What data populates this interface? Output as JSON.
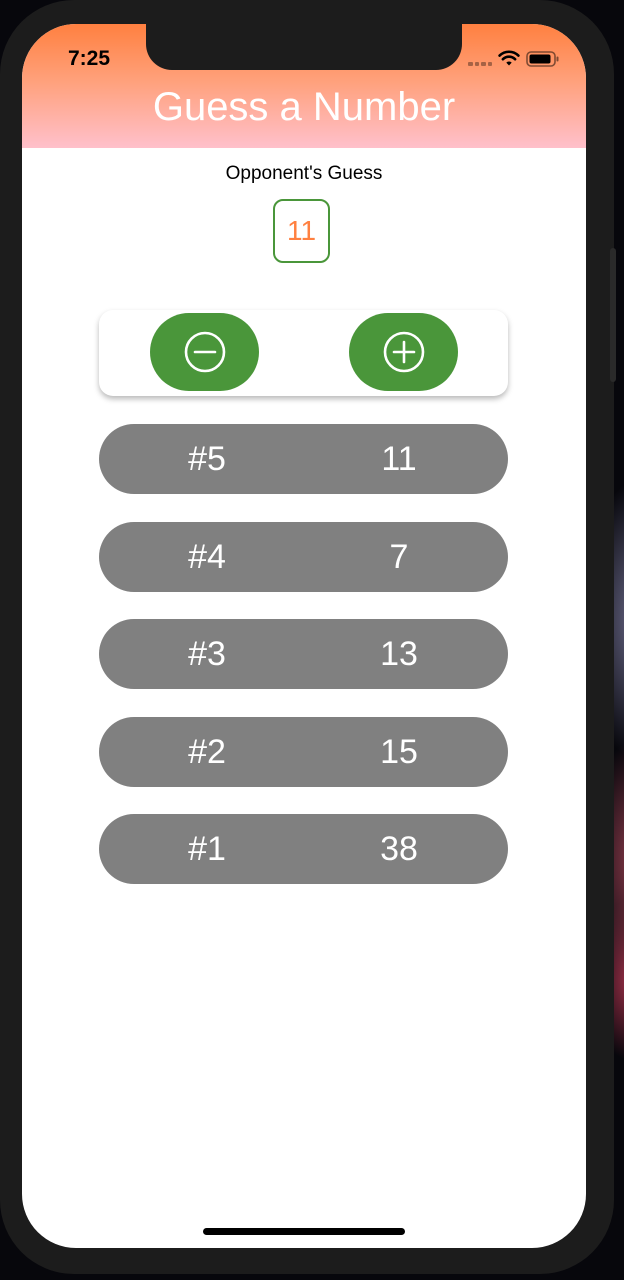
{
  "status_bar": {
    "time": "7:25"
  },
  "header": {
    "title": "Guess a Number"
  },
  "opponent": {
    "label": "Opponent's Guess",
    "current_guess": "11"
  },
  "controls": {
    "lower_icon": "minus-circle-icon",
    "higher_icon": "plus-circle-icon"
  },
  "guesses": [
    {
      "round": "#5",
      "value": "11"
    },
    {
      "round": "#4",
      "value": "7"
    },
    {
      "round": "#3",
      "value": "13"
    },
    {
      "round": "#2",
      "value": "15"
    },
    {
      "round": "#1",
      "value": "38"
    }
  ],
  "colors": {
    "header_gradient_top": "#ff8040",
    "header_gradient_bottom": "#ffc0cb",
    "primary_green": "#4a963a",
    "accent_orange": "#ff8040",
    "row_gray": "#808080"
  }
}
